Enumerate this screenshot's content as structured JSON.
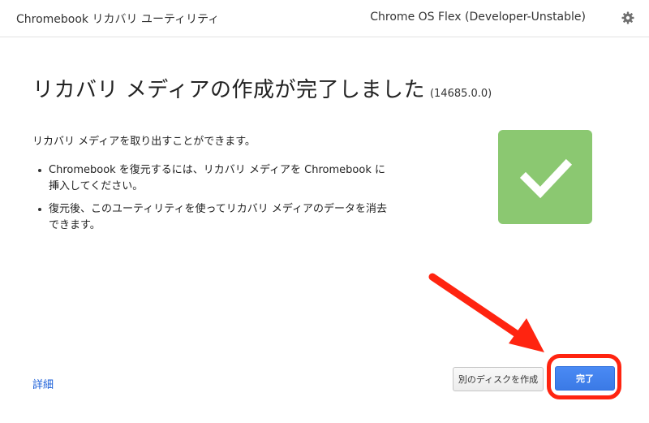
{
  "header": {
    "app_title": "Chromebook リカバリ ユーティリティ",
    "os_version": "Chrome OS Flex (Developer-Unstable)",
    "settings_icon": "gear-icon"
  },
  "main": {
    "title": "リカバリ メディアの作成が完了しました",
    "version": "(14685.0.0)",
    "intro": "リカバリ メディアを取り出すことができます。",
    "bullets": [
      "Chromebook を復元するには、リカバリ メディアを Chromebook に挿入してください。",
      "復元後、このユーティリティを使ってリカバリ メディアのデータを消去できます。"
    ],
    "status_icon": "checkmark-icon"
  },
  "footer": {
    "details_link": "詳細",
    "another_disk_button": "別のディスクを作成",
    "done_button": "完了"
  },
  "colors": {
    "success_tile": "#8bc871",
    "primary_button": "#4a8af4",
    "link": "#1a5ed8",
    "annotation": "#ff2410"
  }
}
